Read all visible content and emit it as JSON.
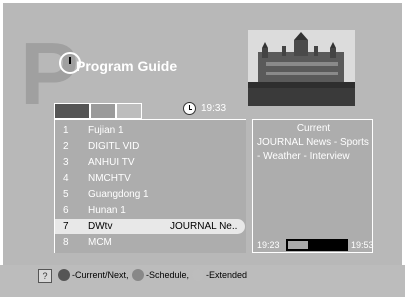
{
  "header": {
    "title": "Program Guide",
    "time": "19:33"
  },
  "channels": [
    {
      "num": "1",
      "name": "Fujian 1",
      "prog": ""
    },
    {
      "num": "2",
      "name": "DIGITL VID",
      "prog": ""
    },
    {
      "num": "3",
      "name": "ANHUI TV",
      "prog": ""
    },
    {
      "num": "4",
      "name": "NMCHTV",
      "prog": ""
    },
    {
      "num": "5",
      "name": "Guangdong 1",
      "prog": ""
    },
    {
      "num": "6",
      "name": "Hunan 1",
      "prog": ""
    },
    {
      "num": "7",
      "name": "DWtv",
      "prog": "JOURNAL Ne.."
    },
    {
      "num": "8",
      "name": "MCM",
      "prog": ""
    }
  ],
  "info": {
    "title": "Current",
    "description": "JOURNAL News - Sports - Weather - Interview",
    "start_time": "19:23",
    "end_time": "19:53",
    "progress": 0.35
  },
  "footer": {
    "help": "?",
    "current_next": "-Current/Next,",
    "schedule": "-Schedule,",
    "extended": "-Extended"
  },
  "colors": {
    "red_key": "#555555",
    "green_key": "#888888",
    "yellow_key": "#bdbdbd"
  }
}
